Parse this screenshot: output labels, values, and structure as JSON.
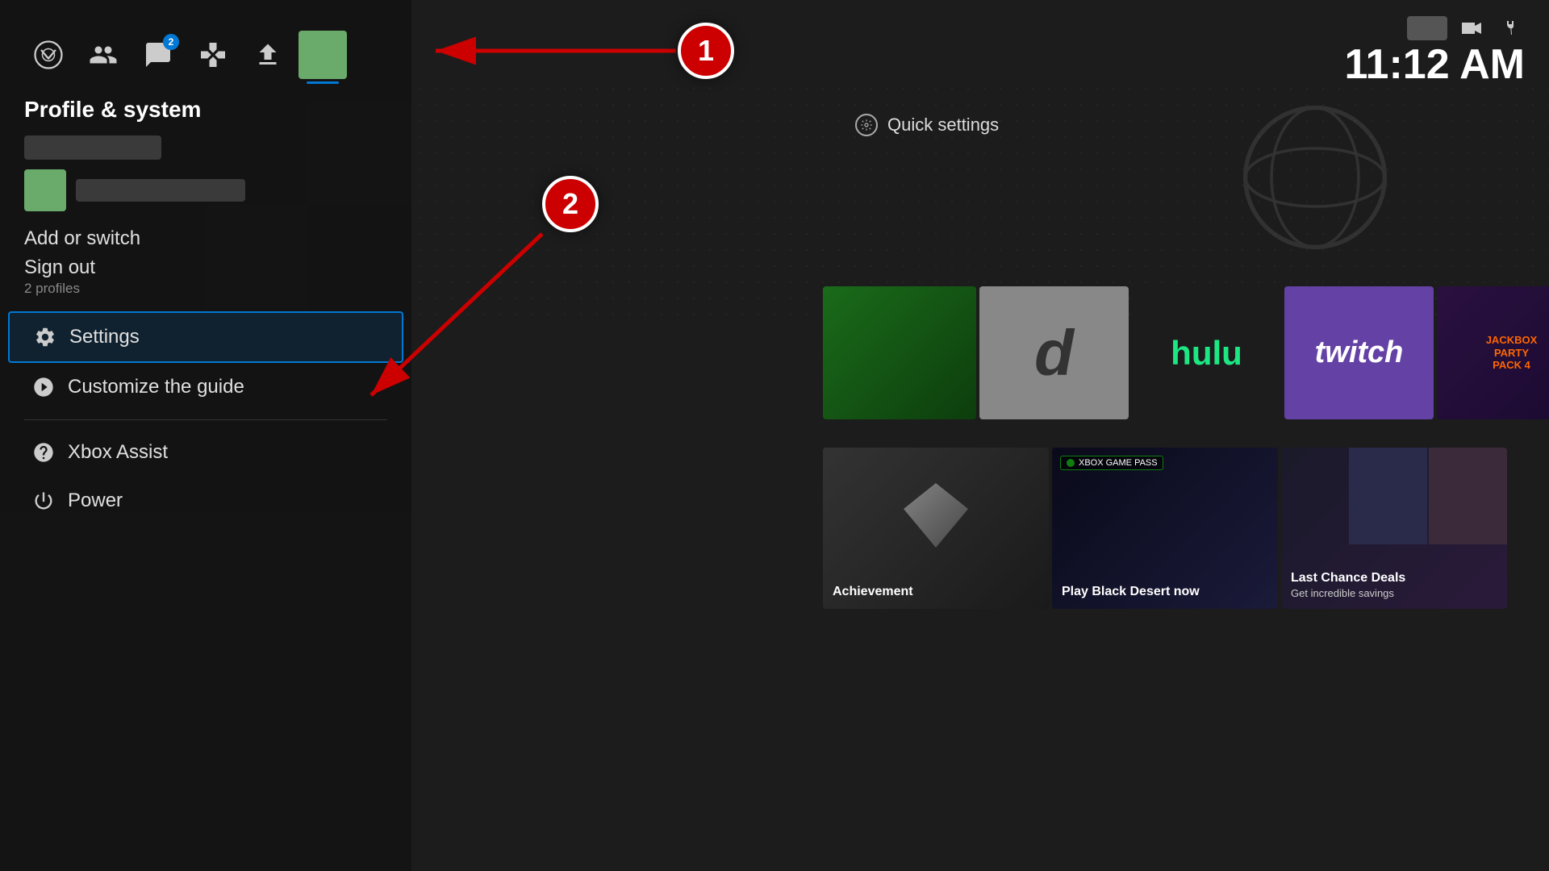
{
  "header": {
    "nav_items": [
      {
        "name": "xbox-home",
        "label": "Xbox"
      },
      {
        "name": "people",
        "label": "People"
      },
      {
        "name": "chat",
        "label": "Chat",
        "badge": "2"
      },
      {
        "name": "controller",
        "label": "Controller"
      },
      {
        "name": "upload",
        "label": "Upload"
      },
      {
        "name": "profile-avatar",
        "label": "Profile Avatar"
      }
    ],
    "clock": "11:12 AM"
  },
  "sidebar": {
    "title": "Profile & system",
    "add_switch": "Add or switch",
    "sign_out": "Sign out",
    "sign_out_sub": "2 profiles",
    "menu_items": [
      {
        "id": "settings",
        "label": "Settings",
        "selected": true
      },
      {
        "id": "customize",
        "label": "Customize the guide",
        "selected": false
      },
      {
        "id": "assist",
        "label": "Xbox Assist",
        "selected": false
      },
      {
        "id": "power",
        "label": "Power",
        "selected": false
      }
    ]
  },
  "main": {
    "quick_settings": "Quick settings",
    "tiles_row1": [
      {
        "id": "gamepass",
        "label": ""
      },
      {
        "id": "discord",
        "label": "d"
      },
      {
        "id": "hulu",
        "label": "hulu"
      },
      {
        "id": "twitch",
        "label": "twitch"
      },
      {
        "id": "jackbox",
        "label": "JACKBOX PARTY PACK 4"
      },
      {
        "id": "store",
        "label": ""
      }
    ],
    "tiles_row2": [
      {
        "id": "achievement",
        "label": "Achievement"
      },
      {
        "id": "blackdesert",
        "label": "Play Black Desert now",
        "badge": "XBOX GAME PASS"
      },
      {
        "id": "lastchance",
        "label": "Last Chance Deals",
        "sublabel": "Get incredible savings"
      }
    ]
  },
  "annotations": [
    {
      "number": "1",
      "id": "anno-1"
    },
    {
      "number": "2",
      "id": "anno-2"
    }
  ]
}
